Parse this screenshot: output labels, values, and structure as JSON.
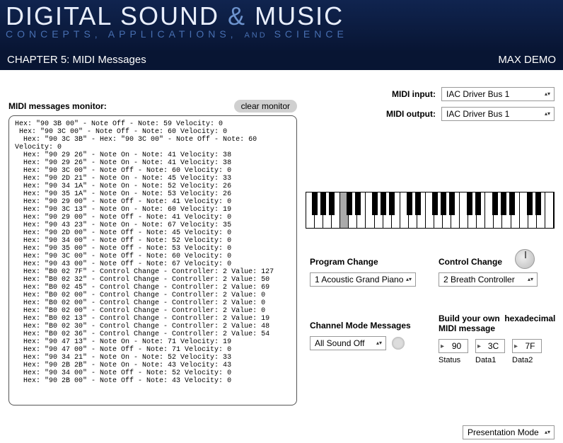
{
  "header": {
    "title_a": "DIGITAL SOUND",
    "title_amp": "&",
    "title_b": "MUSIC",
    "subtitle_a": "CONCEPTS, APPLICATIONS,",
    "subtitle_and": "AND",
    "subtitle_b": "SCIENCE"
  },
  "bar": {
    "chapter": "CHAPTER 5: MIDI Messages",
    "demo": "MAX DEMO"
  },
  "midi_io": {
    "input_label": "MIDI input:",
    "input_value": "IAC Driver Bus 1",
    "output_label": "MIDI output:",
    "output_value": "IAC Driver Bus 1"
  },
  "monitor": {
    "label": "MIDI messages monitor:",
    "clear_label": "clear monitor",
    "text": "Hex: \"90 3B 00\" - Note Off - Note: 59 Velocity: 0\n Hex: \"90 3C 00\" - Note Off - Note: 60 Velocity: 0\n  Hex: \"90 3C 3B\" - Hex: \"90 3C 00\" - Note Off - Note: 60\nVelocity: 0\n  Hex: \"90 29 26\" - Note On - Note: 41 Velocity: 38\n  Hex: \"90 29 26\" - Note On - Note: 41 Velocity: 38\n  Hex: \"90 3C 00\" - Note Off - Note: 60 Velocity: 0\n  Hex: \"90 2D 21\" - Note On - Note: 45 Velocity: 33\n  Hex: \"90 34 1A\" - Note On - Note: 52 Velocity: 26\n  Hex: \"90 35 1A\" - Note On - Note: 53 Velocity: 26\n  Hex: \"90 29 00\" - Note Off - Note: 41 Velocity: 0\n  Hex: \"90 3C 13\" - Note On - Note: 60 Velocity: 19\n  Hex: \"90 29 00\" - Note Off - Note: 41 Velocity: 0\n  Hex: \"90 43 23\" - Note On - Note: 67 Velocity: 35\n  Hex: \"90 2D 00\" - Note Off - Note: 45 Velocity: 0\n  Hex: \"90 34 00\" - Note Off - Note: 52 Velocity: 0\n  Hex: \"90 35 00\" - Note Off - Note: 53 Velocity: 0\n  Hex: \"90 3C 00\" - Note Off - Note: 60 Velocity: 0\n  Hex: \"90 43 00\" - Note Off - Note: 67 Velocity: 0\n  Hex: \"B0 02 7F\" - Control Change - Controller: 2 Value: 127\n  Hex: \"B0 02 32\" - Control Change - Controller: 2 Value: 50\n  Hex: \"B0 02 45\" - Control Change - Controller: 2 Value: 69\n  Hex: \"B0 02 00\" - Control Change - Controller: 2 Value: 0\n  Hex: \"B0 02 00\" - Control Change - Controller: 2 Value: 0\n  Hex: \"B0 02 00\" - Control Change - Controller: 2 Value: 0\n  Hex: \"B0 02 13\" - Control Change - Controller: 2 Value: 19\n  Hex: \"B0 02 30\" - Control Change - Controller: 2 Value: 48\n  Hex: \"B0 02 36\" - Control Change - Controller: 2 Value: 54\n  Hex: \"90 47 13\" - Note On - Note: 71 Velocity: 19\n  Hex: \"90 47 00\" - Note Off - Note: 71 Velocity: 0\n  Hex: \"90 34 21\" - Note On - Note: 52 Velocity: 33\n  Hex: \"90 2B 2B\" - Note On - Note: 43 Velocity: 43\n  Hex: \"90 34 00\" - Note Off - Note: 52 Velocity: 0\n  Hex: \"90 2B 00\" - Note Off - Note: 43 Velocity: 0\n"
  },
  "program_change": {
    "label": "Program Change",
    "value": "1 Acoustic Grand Piano"
  },
  "control_change": {
    "label": "Control Change",
    "value": "2 Breath Controller"
  },
  "channel_mode": {
    "label": "Channel Mode Messages",
    "value": "All Sound Off"
  },
  "build": {
    "label_a": "Build your own",
    "label_b": "hexadecimal MIDI message",
    "status": "90",
    "data1": "3C",
    "data2": "7F",
    "status_label": "Status",
    "data1_label": "Data1",
    "data2_label": "Data2"
  },
  "presentation_mode": {
    "value": "Presentation Mode"
  },
  "piano": {
    "white_key_count": 29,
    "pressed_index": 4,
    "black_positions_by_octave": [
      1,
      2,
      4,
      5,
      6
    ]
  }
}
